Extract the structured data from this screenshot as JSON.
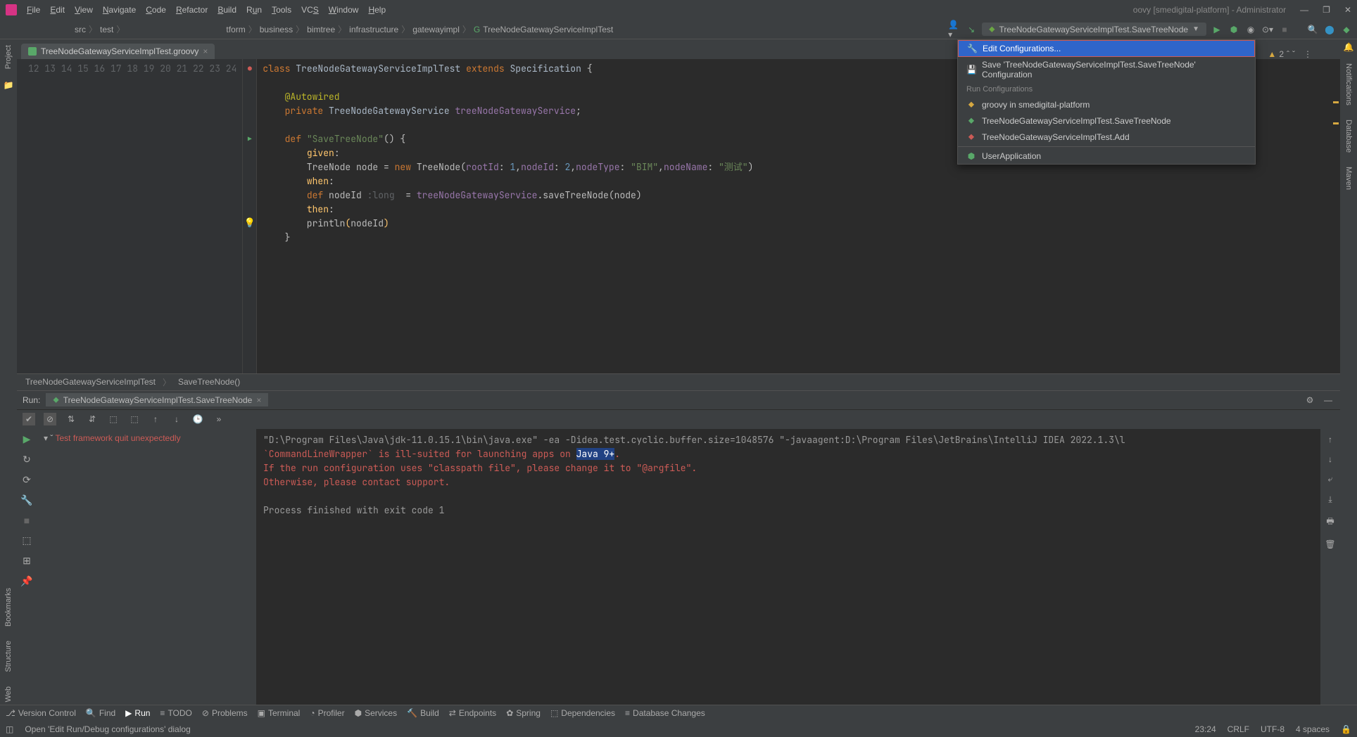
{
  "title": "oovy [smedigital-platform] - Administrator",
  "menu": [
    "File",
    "Edit",
    "View",
    "Navigate",
    "Code",
    "Refactor",
    "Build",
    "Run",
    "Tools",
    "VCS",
    "Window",
    "Help"
  ],
  "navbar": {
    "left": [
      "src",
      "test"
    ],
    "breadcrumb": [
      "tform",
      "business",
      "bimtree",
      "infrastructure",
      "gatewayimpl",
      "TreeNodeGatewayServiceImplTest"
    ],
    "run_config": "TreeNodeGatewayServiceImplTest.SaveTreeNode"
  },
  "editor": {
    "tab": "TreeNodeGatewayServiceImplTest.groovy",
    "warn_count": "2",
    "lines": [
      "12",
      "13",
      "14",
      "15",
      "16",
      "17",
      "18",
      "19",
      "20",
      "21",
      "22",
      "23",
      "24"
    ],
    "breadcrumb1": "TreeNodeGatewayServiceImplTest",
    "breadcrumb2": "SaveTreeNode()"
  },
  "dropdown": {
    "edit_config": "Edit Configurations...",
    "save_config": "Save 'TreeNodeGatewayServiceImplTest.SaveTreeNode' Configuration",
    "header": "Run Configurations",
    "items": [
      "groovy in smedigital-platform",
      "TreeNodeGatewayServiceImplTest.SaveTreeNode",
      "TreeNodeGatewayServiceImplTest.Add"
    ],
    "user_app": "UserApplication"
  },
  "run": {
    "label": "Run:",
    "tab": "TreeNodeGatewayServiceImplTest.SaveTreeNode",
    "tree_msg": "Test framework quit unexpectedly",
    "console_line1": "\"D:\\Program Files\\Java\\jdk-11.0.15.1\\bin\\java.exe\" -ea -Didea.test.cyclic.buffer.size=1048576 \"-javaagent:D:\\Program Files\\JetBrains\\IntelliJ IDEA 2022.1.3\\l",
    "console_err1_a": "`CommandLineWrapper` is ill-suited for launching apps on ",
    "console_err1_sel": "Java 9+",
    "console_err1_b": ".",
    "console_err2": "If the run configuration uses \"classpath file\", please change it to \"@argfile\".",
    "console_err3": "Otherwise, please contact support.",
    "console_exit": "Process finished with exit code 1"
  },
  "bottom_tabs": [
    "Version Control",
    "Find",
    "Run",
    "TODO",
    "Problems",
    "Terminal",
    "Profiler",
    "Services",
    "Build",
    "Endpoints",
    "Spring",
    "Dependencies",
    "Database Changes"
  ],
  "status": {
    "msg": "Open 'Edit Run/Debug configurations' dialog",
    "time": "23:24",
    "eol": "CRLF",
    "encoding": "UTF-8",
    "indent": "4 spaces"
  },
  "left_tabs": [
    "Project",
    "Bookmarks",
    "Structure",
    "Web"
  ],
  "right_tabs": [
    "Notifications",
    "Database",
    "Maven"
  ]
}
